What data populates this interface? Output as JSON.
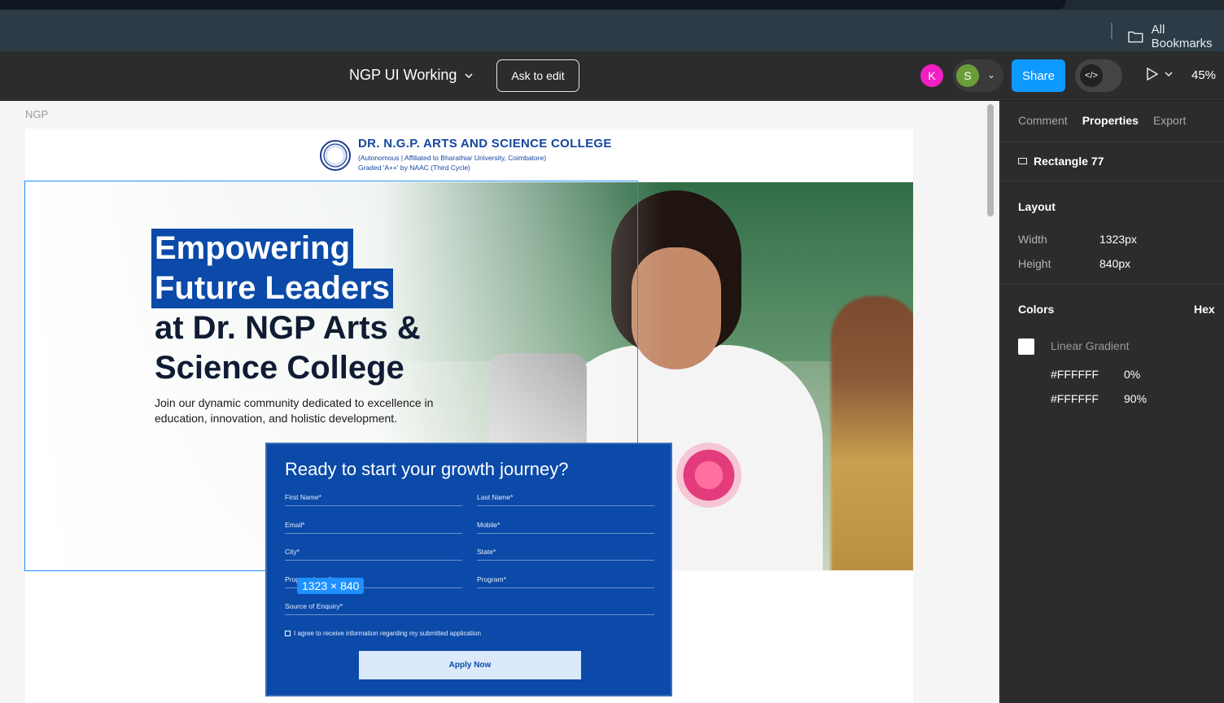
{
  "browser": {
    "bookmarks_label": "All Bookmarks"
  },
  "toolbar": {
    "file_title": "NGP UI Working",
    "ask_to_edit": "Ask to edit",
    "avatars": [
      "K",
      "S"
    ],
    "share": "Share",
    "zoom": "45%"
  },
  "canvas": {
    "frame_label": "NGP",
    "selection_size": "1323 × 840"
  },
  "site": {
    "college_name": "DR. N.G.P. ARTS AND SCIENCE COLLEGE",
    "college_sub1": "(Autonomous | Affiliated to Bharathiar University, Coimbatore)",
    "college_sub2": "Graded 'A++' by NAAC (Third Cycle)",
    "headline_line1": "Empowering",
    "headline_line2": "Future Leaders",
    "headline_line3": "at Dr. NGP Arts &",
    "headline_line4": "Science College",
    "subhead": "Join our dynamic community dedicated to excellence in education, innovation, and holistic development.",
    "form": {
      "title": "Ready to start your growth journey?",
      "fields": [
        "First Name*",
        "Last Name*",
        "Email*",
        "Mobile*",
        "City*",
        "State*",
        "Program Level*",
        "Program*",
        "Source of Enquiry*"
      ],
      "agree": "I agree to receive information regarding my submitted application",
      "apply": "Apply Now"
    }
  },
  "panel": {
    "tabs": [
      "Comment",
      "Properties",
      "Export"
    ],
    "layer_name": "Rectangle 77",
    "layout_title": "Layout",
    "width_label": "Width",
    "width_value": "1323px",
    "height_label": "Height",
    "height_value": "840px",
    "colors_title": "Colors",
    "color_format": "Hex",
    "fill_type": "Linear Gradient",
    "stops": [
      {
        "color": "#FFFFFF",
        "position": "0%"
      },
      {
        "color": "#FFFFFF",
        "position": "90%"
      }
    ]
  },
  "colors": {
    "accent_blue": "#0d99ff",
    "brand_blue": "#0b4aa8"
  }
}
